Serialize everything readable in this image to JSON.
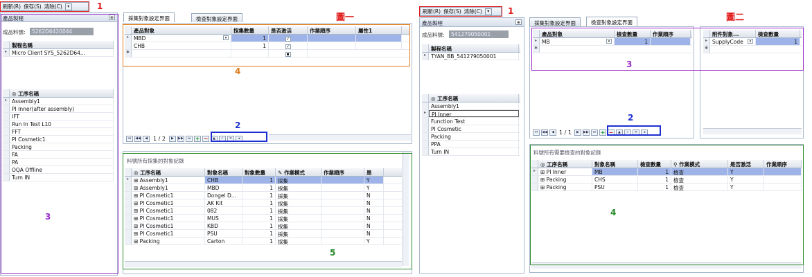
{
  "toolbar": {
    "refresh": "刷新(R)",
    "save": "保存(S)",
    "clear": "清除(C)"
  },
  "annotations": {
    "a1": "1",
    "a2": "2",
    "a3": "3",
    "a4": "4",
    "a5": "5",
    "fig1": "圖一",
    "fig2": "圖二"
  },
  "left": {
    "section_title": "產品製程",
    "product_label": "成品料號:",
    "product_value": "5262D6420044",
    "process_header": "製程名稱",
    "process_rows": [
      "Micro Client SYS_5262D64..."
    ],
    "work_header": "工序名稱",
    "work_rows": [
      "Assembly1",
      "PI Inner(after assembly)",
      "IFT",
      "Run In Test L10",
      "FFT",
      "PI Cosmetic1",
      "Packing",
      "FA",
      "PA",
      "OQA Offline",
      "Turn IN"
    ]
  },
  "fig1": {
    "tab_collect": "採集對象設定界面",
    "tab_check": "檢查對象設定界面",
    "grid_headers": [
      "產品對象",
      "採集數量",
      "是否激活",
      "作業順序",
      "屬性1"
    ],
    "grid_rows": [
      {
        "obj": "MBD",
        "qty": "1",
        "active": "✓"
      },
      {
        "obj": "CHB",
        "qty": "1",
        "active": "✓"
      }
    ],
    "nav_page": "1 / 2",
    "bottom_title": "料號所有採集的對象記錄",
    "bottom_headers": [
      "工序名稱",
      "對象名稱",
      "對象數量",
      "作業模式",
      "作業順序",
      "是"
    ],
    "bottom_rows": [
      {
        "step": "Assembly1",
        "obj": "CHB",
        "qty": "1",
        "mode": "採集",
        "flag": "Y"
      },
      {
        "step": "Assembly1",
        "obj": "MBD",
        "qty": "1",
        "mode": "採集",
        "flag": "Y"
      },
      {
        "step": "PI Cosmetic1",
        "obj": "Dongel D...",
        "qty": "1",
        "mode": "採集",
        "flag": "N"
      },
      {
        "step": "PI Cosmetic1",
        "obj": "AK Kit",
        "qty": "1",
        "mode": "採集",
        "flag": "N"
      },
      {
        "step": "PI Cosmetic1",
        "obj": "082",
        "qty": "1",
        "mode": "採集",
        "flag": "N"
      },
      {
        "step": "PI Cosmetic1",
        "obj": "MUS",
        "qty": "1",
        "mode": "採集",
        "flag": "N"
      },
      {
        "step": "PI Cosmetic1",
        "obj": "KBD",
        "qty": "1",
        "mode": "採集",
        "flag": "N"
      },
      {
        "step": "PI Cosmetic1",
        "obj": "PSU",
        "qty": "1",
        "mode": "採集",
        "flag": "N"
      },
      {
        "step": "Packing",
        "obj": "Carton",
        "qty": "1",
        "mode": "採集",
        "flag": "Y"
      }
    ]
  },
  "right_left": {
    "section_title": "產品製程",
    "product_label": "成品料號:",
    "product_value": "541279050001",
    "process_header": "製程名稱",
    "process_rows": [
      "TYAN_BB_541279050001"
    ],
    "work_header": "工序名稱",
    "work_rows": [
      "Assembly1",
      "PI Inner",
      "Function Test",
      "PI Cosmetic",
      "Packing",
      "PPA",
      "Turn IN"
    ]
  },
  "fig2": {
    "tab_collect": "採集對象設定界面",
    "tab_check": "檢查對象設定界面",
    "grid_headers": [
      "產品對象",
      "檢查數量",
      "作業順序"
    ],
    "grid_rows": [
      {
        "obj": "MB",
        "qty": "1"
      }
    ],
    "side_headers": [
      "附件對象...",
      "檢查數量"
    ],
    "side_rows": [
      {
        "obj": "SupplyCode",
        "qty": "1"
      }
    ],
    "nav_page": "1 / 1",
    "bottom_title": "料號所有需要檢查的對象記錄",
    "bottom_headers": [
      "工序名稱",
      "對象名稱",
      "檢查數量",
      "作業模式",
      "是否激活",
      "作業順序"
    ],
    "bottom_rows": [
      {
        "step": "PI Inner",
        "obj": "MB",
        "qty": "1",
        "mode": "檢查",
        "active": "Y"
      },
      {
        "step": "Packing",
        "obj": "CHS",
        "qty": "1",
        "mode": "檢查",
        "active": "Y"
      },
      {
        "step": "Packing",
        "obj": "PSU",
        "qty": "1",
        "mode": "檢查",
        "active": "Y"
      }
    ]
  },
  "colors": {
    "annotation_red": "#e01818",
    "annotation_purple": "#9b2fc9",
    "annotation_orange": "#e07a18",
    "annotation_blue": "#1e2fd0",
    "annotation_green": "#2a8a2a",
    "selection": "#9eb4e8"
  }
}
